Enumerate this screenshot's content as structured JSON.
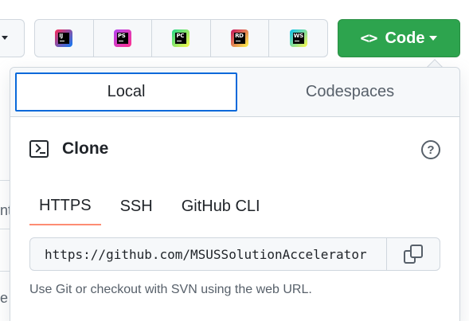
{
  "ide_buttons": [
    {
      "icon": "intellij-idea-icon",
      "label": "IJ",
      "color": "#fe2857",
      "color2": "#087cfa"
    },
    {
      "icon": "phpstorm-icon",
      "label": "PS",
      "color": "#b345f1",
      "color2": "#ff318c"
    },
    {
      "icon": "pycharm-icon",
      "label": "PC",
      "color": "#21d789",
      "color2": "#fcf84a"
    },
    {
      "icon": "rider-icon",
      "label": "RD",
      "color": "#c90f5e",
      "color2": "#dd1265"
    },
    {
      "icon": "webstorm-icon",
      "label": "WS",
      "color": "#07c3f2",
      "color2": "#fcf84a"
    }
  ],
  "code_button": {
    "icon": "<>",
    "label": "Code"
  },
  "tabs": [
    "Local",
    "Codespaces"
  ],
  "clone": {
    "title": "Clone",
    "help": "?"
  },
  "protocol_tabs": [
    "HTTPS",
    "SSH",
    "GitHub CLI"
  ],
  "url": {
    "value": "https://github.com/MSUSSolutionAccelerator"
  },
  "hint": "Use Git or checkout with SVN using the web URL.",
  "background": {
    "chars": [
      "nt",
      "e"
    ]
  },
  "colors": {
    "accent": "#2da44e",
    "focus": "#0969da",
    "underline": "#fd8c73"
  }
}
